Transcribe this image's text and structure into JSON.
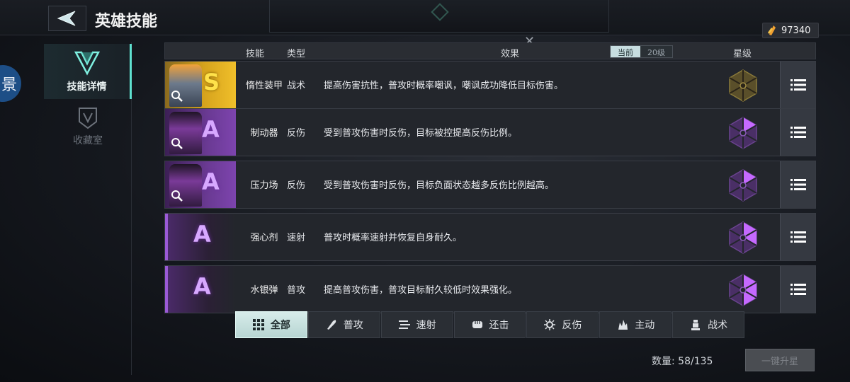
{
  "header": {
    "title": "英雄技能",
    "currency_amount": "97340",
    "close_symbol": "✕"
  },
  "sidenav": {
    "items": [
      {
        "label": "技能详情",
        "icon": "v-emblem-icon",
        "active": true
      },
      {
        "label": "收藏室",
        "icon": "shield-v-icon",
        "active": false
      }
    ],
    "edge_glyph": "景"
  },
  "table": {
    "headers": {
      "skill": "技能",
      "type": "类型",
      "effect": "效果",
      "star": "星级"
    },
    "level_toggle": {
      "current": "当前",
      "level20": "20级"
    },
    "rows": [
      {
        "grade": "S",
        "name": "惰性装甲",
        "type": "战术",
        "effect": "提高伤害抗性，普攻时概率嘲讽，嘲讽成功降低目标伤害。",
        "star_color": "#8a7a3a"
      },
      {
        "grade": "A",
        "name": "制动器",
        "type": "反伤",
        "effect": "受到普攻伤害时反伤，目标被控提高反伤比例。",
        "star_color": "#b054e8"
      },
      {
        "grade": "A",
        "name": "压力场",
        "type": "反伤",
        "effect": "受到普攻伤害时反伤，目标负面状态越多反伤比例越高。",
        "star_color": "#b054e8"
      },
      {
        "grade": "A",
        "name": "强心剂",
        "type": "速射",
        "effect": "普攻时概率速射并恢复自身耐久。",
        "star_color": "#b054e8"
      },
      {
        "grade": "A",
        "name": "水银弹",
        "type": "普攻",
        "effect": "提高普攻伤害，普攻目标耐久较低时效果强化。",
        "star_color": "#b054e8"
      }
    ]
  },
  "filters": [
    {
      "label": "全部",
      "icon": "grid-icon",
      "active": true
    },
    {
      "label": "普攻",
      "icon": "bullet-icon",
      "active": false
    },
    {
      "label": "速射",
      "icon": "rapid-fire-icon",
      "active": false
    },
    {
      "label": "还击",
      "icon": "fist-icon",
      "active": false
    },
    {
      "label": "反伤",
      "icon": "gear-burst-icon",
      "active": false
    },
    {
      "label": "主动",
      "icon": "flame-icon",
      "active": false
    },
    {
      "label": "战术",
      "icon": "tower-icon",
      "active": false
    }
  ],
  "footer": {
    "count_label": "数量: 58/135",
    "upgrade_label": "一键升星"
  },
  "colors": {
    "accent": "#5fe0cf",
    "grade_s": "#ffe24a",
    "grade_a": "#d7a8ff"
  }
}
